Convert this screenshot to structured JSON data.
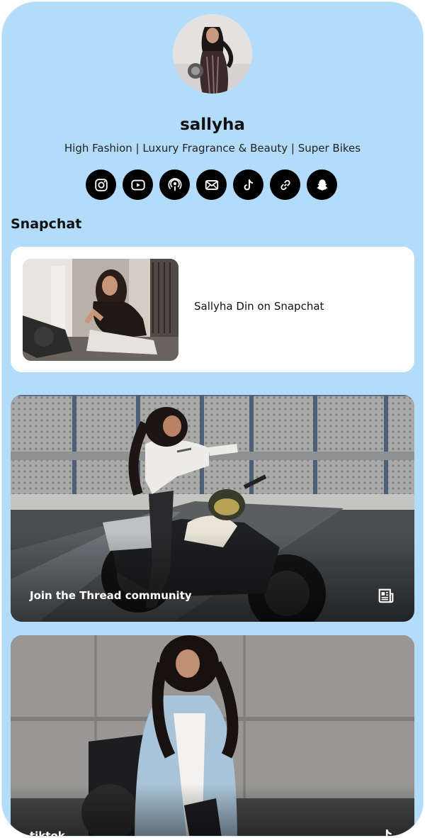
{
  "profile": {
    "username": "sallyha",
    "bio": "High Fashion | Luxury Fragrance & Beauty | Super Bikes",
    "avatar_alt": "profile photo"
  },
  "socials": [
    {
      "name": "instagram-icon"
    },
    {
      "name": "youtube-icon"
    },
    {
      "name": "podcast-icon"
    },
    {
      "name": "email-icon"
    },
    {
      "name": "tiktok-icon"
    },
    {
      "name": "link-icon"
    },
    {
      "name": "snapchat-icon"
    }
  ],
  "section": {
    "title": "Snapchat"
  },
  "snap_card": {
    "label": "Sallyha Din on Snapchat"
  },
  "thread_card": {
    "label": "Join the Thread community",
    "icon": "newspaper-icon"
  },
  "tiktok_card": {
    "label": "tiktok",
    "icon": "tiktok-icon"
  },
  "colors": {
    "page_background": "#b3dcfb",
    "card_background": "#ffffff",
    "icon_circle": "#000000"
  }
}
